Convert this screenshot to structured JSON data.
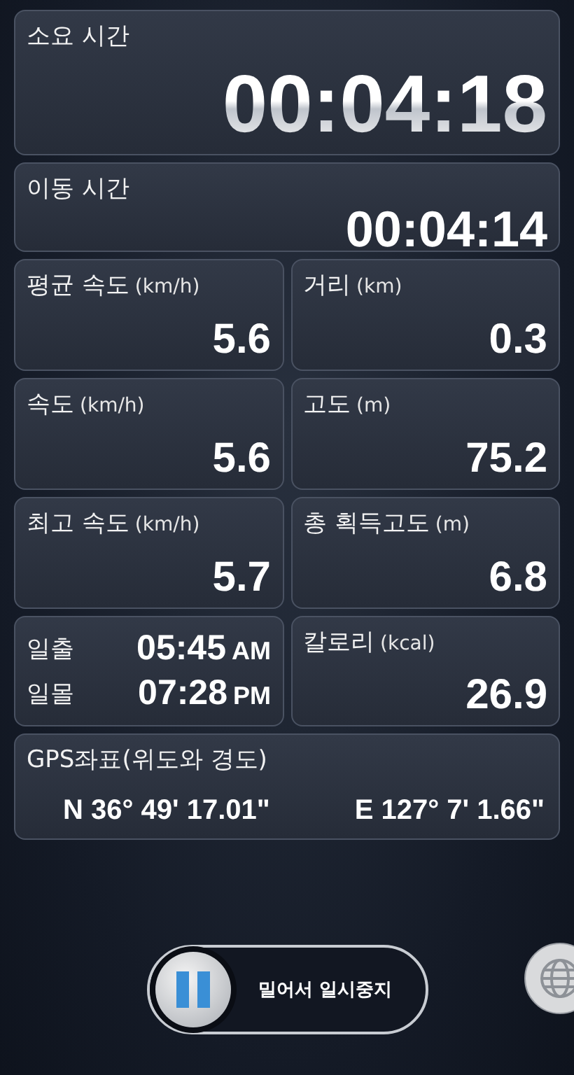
{
  "elapsed": {
    "label": "소요 시간",
    "value": "00:04:18"
  },
  "moving": {
    "label": "이동 시간",
    "value": "00:04:14"
  },
  "stats": [
    {
      "label": "평균 속도",
      "unit": "(km/h)",
      "value": "5.6"
    },
    {
      "label": "거리",
      "unit": "(km)",
      "value": "0.3"
    },
    {
      "label": "속도",
      "unit": "(km/h)",
      "value": "5.6"
    },
    {
      "label": "고도",
      "unit": "(m)",
      "value": "75.2"
    },
    {
      "label": "최고 속도",
      "unit": "(km/h)",
      "value": "5.7"
    },
    {
      "label": "총 획득고도",
      "unit": "(m)",
      "value": "6.8"
    }
  ],
  "sun": [
    {
      "label": "일출",
      "time": "05:45",
      "ampm": "AM"
    },
    {
      "label": "일몰",
      "time": "07:28",
      "ampm": "PM"
    }
  ],
  "calories": {
    "label": "칼로리",
    "unit": "(kcal)",
    "value": "26.9"
  },
  "gps": {
    "label": "GPS좌표(위도와 경도)",
    "lat": "N 36° 49' 17.01\"",
    "lon": "E 127° 7' 1.66\""
  },
  "pause_slider": {
    "label": "밀어서 일시중지",
    "level": 0
  }
}
